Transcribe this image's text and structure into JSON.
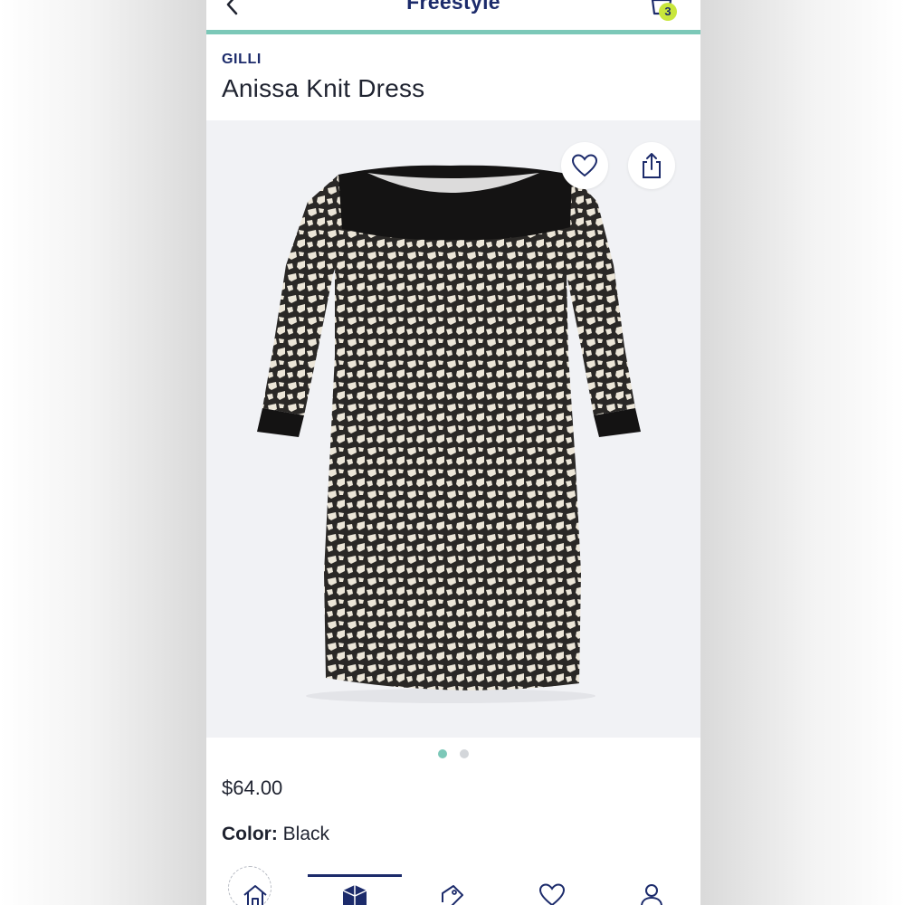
{
  "header": {
    "title": "Freestyle",
    "cart_count": "3",
    "icons": {
      "back": "chevron-left-icon",
      "bag": "shopping-bag-icon"
    }
  },
  "product": {
    "brand": "GILLI",
    "name": "Anissa Knit Dress",
    "price": "$64.00",
    "color_label": "Color:",
    "color_value": "Black",
    "image": "dress-photo",
    "gallery": {
      "images_total": 2,
      "active_index": 0
    }
  },
  "actions": {
    "favorite_icon": "heart-icon",
    "share_icon": "share-icon"
  },
  "tabbar": {
    "items": [
      {
        "icon": "home-icon"
      },
      {
        "icon": "box-icon",
        "active": true
      },
      {
        "icon": "tag-icon"
      },
      {
        "icon": "heart-icon"
      },
      {
        "icon": "person-icon"
      }
    ]
  },
  "colors": {
    "brand_navy": "#1c2b6b",
    "accent_teal": "#7cc8b8",
    "badge_lime": "#c8e63c",
    "gallery_bg": "#f1f2f5"
  }
}
